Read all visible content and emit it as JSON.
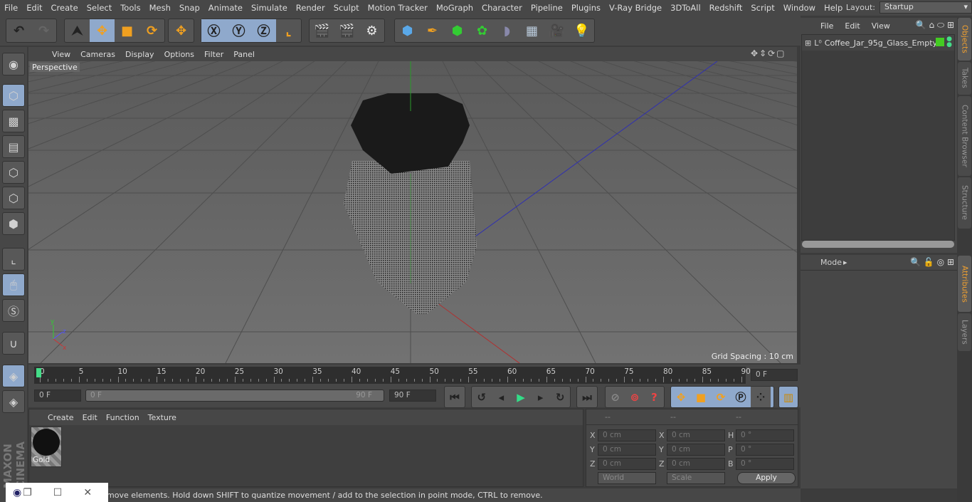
{
  "menu": [
    "File",
    "Edit",
    "Create",
    "Select",
    "Tools",
    "Mesh",
    "Snap",
    "Animate",
    "Simulate",
    "Render",
    "Sculpt",
    "Motion Tracker",
    "MoGraph",
    "Character",
    "Pipeline",
    "Plugins",
    "V-Ray Bridge",
    "3DToAll",
    "Redshift",
    "Script",
    "Window",
    "Help"
  ],
  "layout": {
    "label": "Layout:",
    "value": "Startup"
  },
  "viewport": {
    "menu": [
      "View",
      "Cameras",
      "Display",
      "Options",
      "Filter",
      "Panel"
    ],
    "camera": "Perspective",
    "grid_spacing": "Grid Spacing : 10 cm"
  },
  "timeline": {
    "ticks": [
      "0",
      "5",
      "10",
      "15",
      "20",
      "25",
      "30",
      "35",
      "40",
      "45",
      "50",
      "55",
      "60",
      "65",
      "70",
      "75",
      "80",
      "85",
      "90"
    ],
    "current_frame": "0 F",
    "start": "0 F",
    "range_start": "0 F",
    "range_end": "90 F",
    "end": "90 F"
  },
  "materials": {
    "menu": [
      "Create",
      "Edit",
      "Function",
      "Texture"
    ],
    "items": [
      {
        "name": "Gold"
      }
    ]
  },
  "coords": {
    "headers": [
      "--",
      "--",
      "--"
    ],
    "rows": [
      {
        "a": "X",
        "av": "0 cm",
        "b": "X",
        "bv": "0 cm",
        "c": "H",
        "cv": "0 °"
      },
      {
        "a": "Y",
        "av": "0 cm",
        "b": "Y",
        "bv": "0 cm",
        "c": "P",
        "cv": "0 °"
      },
      {
        "a": "Z",
        "av": "0 cm",
        "b": "Z",
        "bv": "0 cm",
        "c": "B",
        "cv": "0 °"
      }
    ],
    "mode": "World",
    "type": "Scale",
    "apply": "Apply"
  },
  "status": "move elements. Hold down SHIFT to quantize movement / add to the selection in point mode, CTRL to remove.",
  "objects": {
    "menu": [
      "File",
      "Edit",
      "View"
    ],
    "items": [
      {
        "name": "Coffee_Jar_95g_Glass_Empty",
        "color": "#44cc22"
      }
    ]
  },
  "attributes": {
    "menu": "Mode"
  },
  "side_tabs_top": [
    "Objects",
    "Takes",
    "Content Browser",
    "Structure"
  ],
  "side_tabs_bottom": [
    "Attributes",
    "Layers"
  ],
  "logo": "MAXON CINEMA 4D"
}
